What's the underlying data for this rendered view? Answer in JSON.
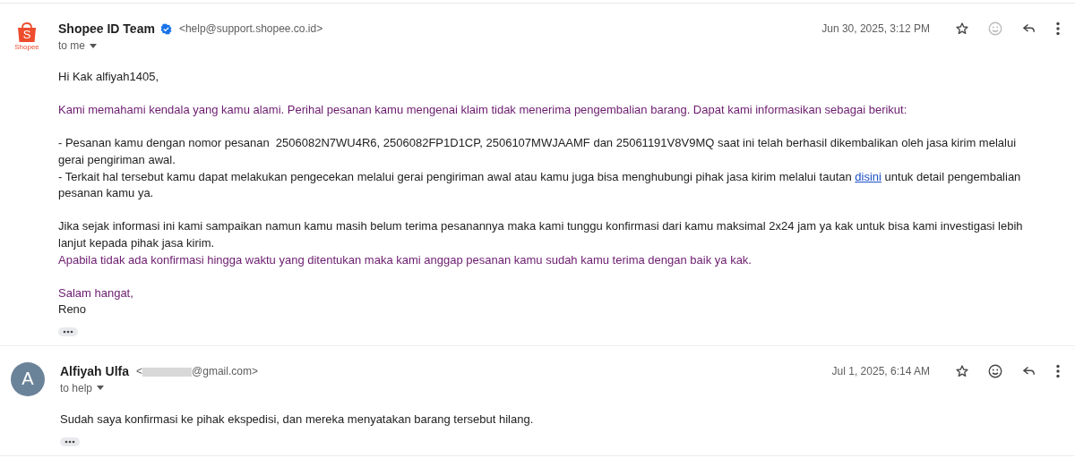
{
  "messages": [
    {
      "sender": {
        "name": "Shopee ID Team",
        "verified": true,
        "email": "<help@support.shopee.co.id>",
        "redacted": false
      },
      "avatar": {
        "kind": "logo",
        "letter": "S",
        "caption": "Shopee"
      },
      "recipient": "to me",
      "date": "Jun 30, 2025, 3:12 PM",
      "emoji_enabled": false,
      "blocks": [
        [
          {
            "color": "#222222",
            "parts": [
              {
                "text": "Hi Kak alfiyah1405,"
              }
            ]
          }
        ],
        [
          {
            "color": "#6b1b6e",
            "parts": [
              {
                "text": "Kami memahami kendala yang kamu alami. Perihal pesanan kamu mengenai klaim tidak menerima pengembalian barang. Dapat kami informasikan sebagai berikut:"
              }
            ]
          }
        ],
        [
          {
            "color": "#222222",
            "parts": [
              {
                "text": "- Pesanan kamu dengan nomor pesanan  2506082N7WU4R6, 2506082FP1D1CP, 2506107MWJAAMF dan 25061191V8V9MQ saat ini telah berhasil dikembalikan oleh jasa kirim melalui gerai pengiriman awal."
              }
            ]
          },
          {
            "color": "#222222",
            "parts": [
              {
                "text": "- Terkait hal tersebut kamu dapat melakukan pengecekan melalui gerai pengiriman awal atau kamu juga bisa menghubungi pihak jasa kirim melalui tautan "
              },
              {
                "text": "disini",
                "kind": "link"
              },
              {
                "text": " untuk detail pengembalian pesanan kamu ya."
              }
            ]
          }
        ],
        [
          {
            "color": "#222222",
            "parts": [
              {
                "text": "Jika sejak informasi ini kami sampaikan namun kamu masih belum terima pesanannya maka kami tunggu konfirmasi dari kamu maksimal 2x24 jam ya kak untuk bisa kami investigasi lebih lanjut kepada pihak jasa kirim."
              }
            ]
          },
          {
            "color": "#6b1b6e",
            "parts": [
              {
                "text": "Apabila tidak ada konfirmasi hingga waktu yang ditentukan maka kami anggap pesanan kamu sudah kamu terima dengan baik ya kak."
              }
            ]
          }
        ],
        [
          {
            "color": "#6b1b6e",
            "parts": [
              {
                "text": "Salam hangat,"
              }
            ]
          },
          {
            "color": "#222222",
            "parts": [
              {
                "text": "Reno"
              }
            ]
          }
        ]
      ]
    },
    {
      "sender": {
        "name": "Alfiyah Ulfa",
        "verified": false,
        "email": "<",
        "email_end": "@gmail.com>",
        "redacted": true
      },
      "avatar": {
        "kind": "initial",
        "letter": "A"
      },
      "recipient": "to help",
      "date": "Jul 1, 2025, 6:14 AM",
      "emoji_enabled": true,
      "blocks": [
        [
          {
            "color": "#222222",
            "parts": [
              {
                "text": "Sudah saya konfirmasi ke pihak ekspedisi, dan mereka menyatakan barang tersebut hilang."
              }
            ]
          }
        ]
      ]
    }
  ]
}
